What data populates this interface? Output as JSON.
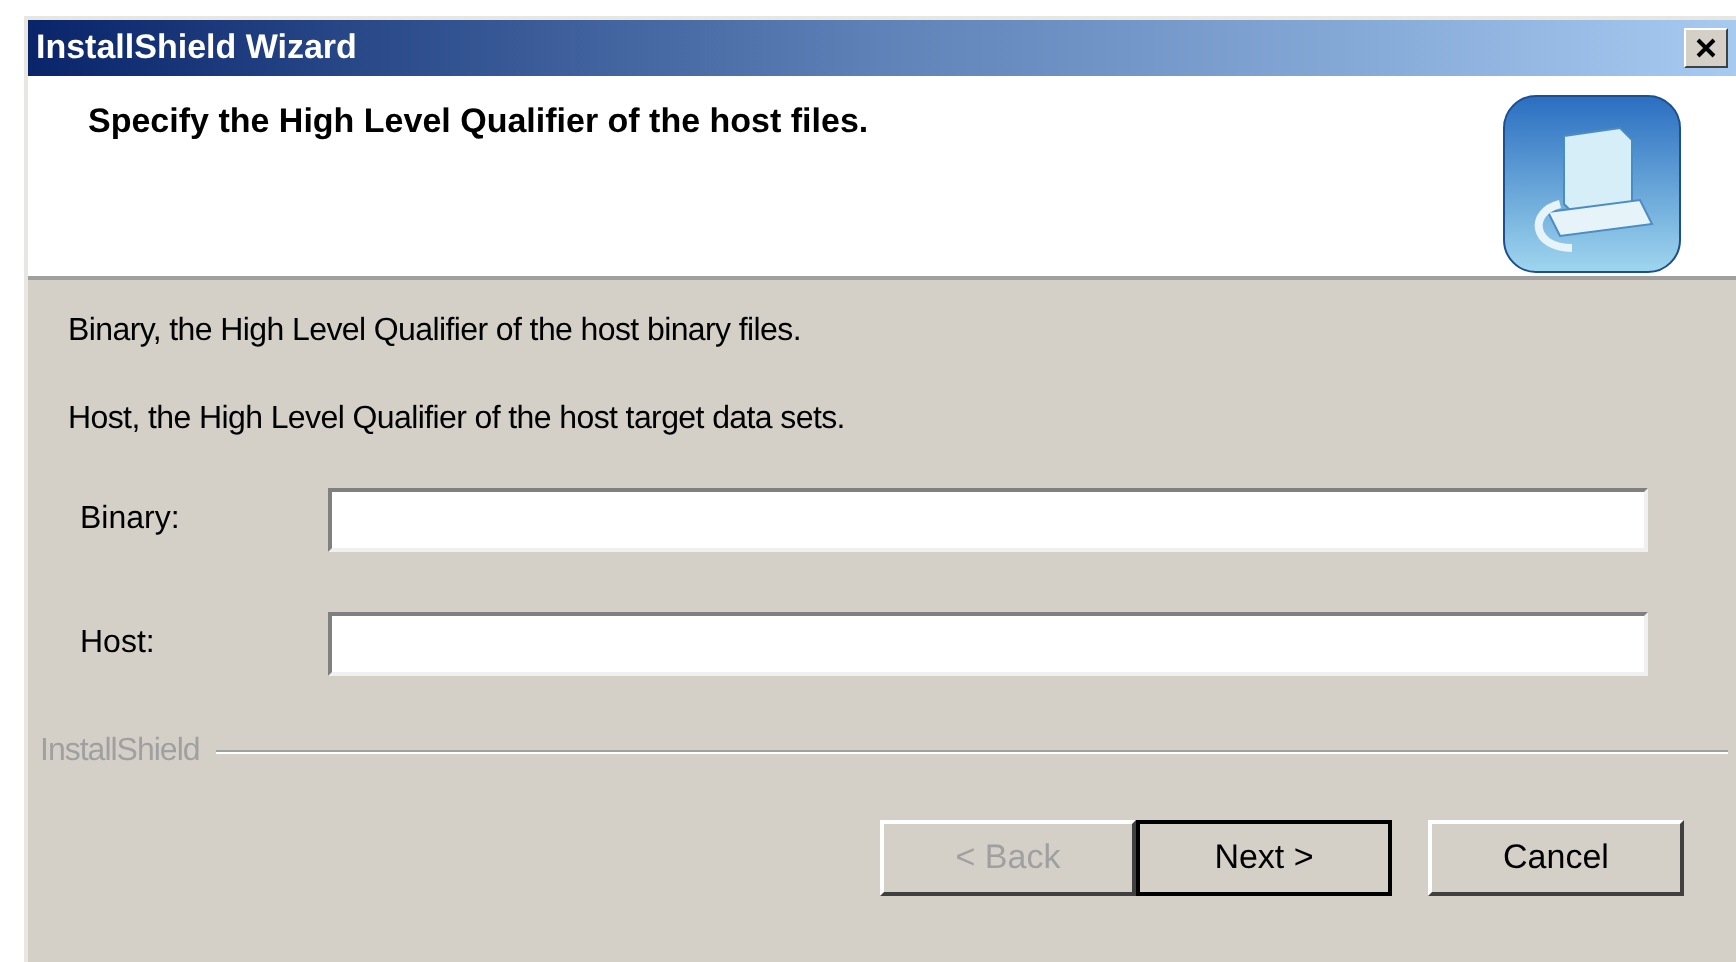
{
  "window": {
    "title": "InstallShield Wizard"
  },
  "header": {
    "title": "Specify the High Level Qualifier of the host files."
  },
  "descriptions": [
    "Binary, the High Level Qualifier of the host binary files.",
    "Host, the High Level Qualifier of the host target data sets."
  ],
  "fields": [
    {
      "label": "Binary:"
    },
    {
      "label": "Host:"
    }
  ],
  "brand": "InstallShield",
  "buttons": [
    {
      "label": "< Back",
      "disabled": true,
      "default": false
    },
    {
      "label": "Next >",
      "disabled": false,
      "default": true
    },
    {
      "label": "Cancel",
      "disabled": false,
      "default": false
    }
  ]
}
